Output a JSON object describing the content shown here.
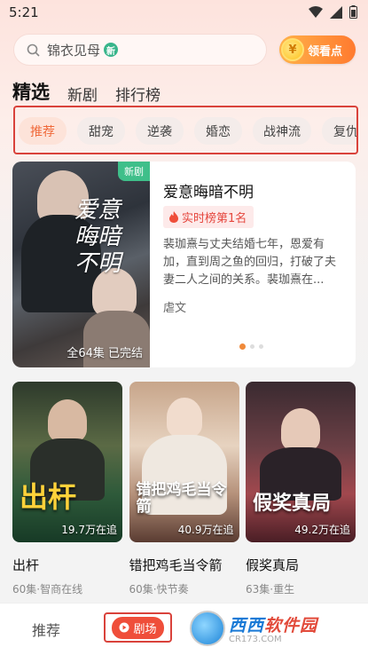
{
  "status": {
    "time": "5:21"
  },
  "search": {
    "text": "锦衣见母",
    "badge": "新"
  },
  "coin_button": {
    "coin_symbol": "¥",
    "label": "领看点"
  },
  "main_tabs": [
    {
      "label": "精选",
      "active": true
    },
    {
      "label": "新剧",
      "active": false
    },
    {
      "label": "排行榜",
      "active": false
    }
  ],
  "chips": [
    {
      "label": "推荐",
      "active": true
    },
    {
      "label": "甜宠",
      "active": false
    },
    {
      "label": "逆袭",
      "active": false
    },
    {
      "label": "婚恋",
      "active": false
    },
    {
      "label": "战神流",
      "active": false
    },
    {
      "label": "复仇",
      "active": false
    }
  ],
  "featured": {
    "title": "爱意晦暗不明",
    "badge": "新剧",
    "poster_art": "爱意晦暗不明",
    "poster_caption": "全64集  已完结",
    "rank_label": "实时榜第1名",
    "description": "裴珈熹与丈夫结婚七年，恩爱有加，直到周之鱼的回归，打破了夫妻二人之间的关系。裴珈熹在...",
    "tag": "虐文",
    "carousel_index": 1,
    "carousel_total": 3
  },
  "grid": [
    {
      "title": "出杆",
      "count": "19.7万在追",
      "meta": "60集·智商在线",
      "art": "出杆"
    },
    {
      "title": "错把鸡毛当令箭",
      "count": "40.9万在追",
      "meta": "60集·快节奏",
      "art": "错把鸡毛当令箭"
    },
    {
      "title": "假奖真局",
      "count": "49.2万在追",
      "meta": "63集·重生",
      "art": "假奖真局"
    }
  ],
  "bottom_nav": {
    "recommend_label": "推荐",
    "theater_label": "剧场"
  },
  "watermark": {
    "main_a": "西西",
    "main_b": "软件园",
    "sub": "CR173.COM"
  },
  "colors": {
    "accent": "#ef4e3a",
    "chip_active_text": "#f06a3b",
    "highlight_box": "#d9423b"
  }
}
